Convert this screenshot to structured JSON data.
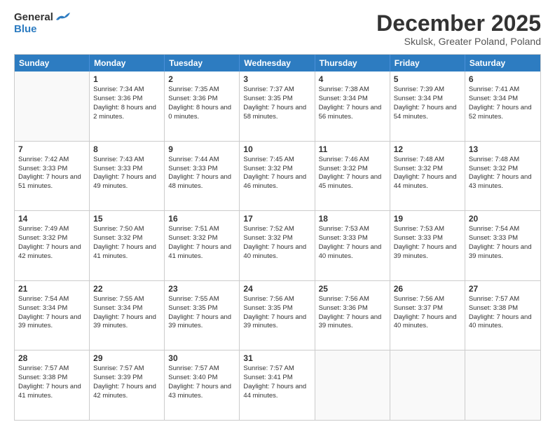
{
  "logo": {
    "line1": "General",
    "line2": "Blue"
  },
  "title": "December 2025",
  "subtitle": "Skulsk, Greater Poland, Poland",
  "header": {
    "days": [
      "Sunday",
      "Monday",
      "Tuesday",
      "Wednesday",
      "Thursday",
      "Friday",
      "Saturday"
    ]
  },
  "weeks": [
    [
      {
        "day": "",
        "sunrise": "",
        "sunset": "",
        "daylight": ""
      },
      {
        "day": "1",
        "sunrise": "Sunrise: 7:34 AM",
        "sunset": "Sunset: 3:36 PM",
        "daylight": "Daylight: 8 hours and 2 minutes."
      },
      {
        "day": "2",
        "sunrise": "Sunrise: 7:35 AM",
        "sunset": "Sunset: 3:36 PM",
        "daylight": "Daylight: 8 hours and 0 minutes."
      },
      {
        "day": "3",
        "sunrise": "Sunrise: 7:37 AM",
        "sunset": "Sunset: 3:35 PM",
        "daylight": "Daylight: 7 hours and 58 minutes."
      },
      {
        "day": "4",
        "sunrise": "Sunrise: 7:38 AM",
        "sunset": "Sunset: 3:34 PM",
        "daylight": "Daylight: 7 hours and 56 minutes."
      },
      {
        "day": "5",
        "sunrise": "Sunrise: 7:39 AM",
        "sunset": "Sunset: 3:34 PM",
        "daylight": "Daylight: 7 hours and 54 minutes."
      },
      {
        "day": "6",
        "sunrise": "Sunrise: 7:41 AM",
        "sunset": "Sunset: 3:34 PM",
        "daylight": "Daylight: 7 hours and 52 minutes."
      }
    ],
    [
      {
        "day": "7",
        "sunrise": "Sunrise: 7:42 AM",
        "sunset": "Sunset: 3:33 PM",
        "daylight": "Daylight: 7 hours and 51 minutes."
      },
      {
        "day": "8",
        "sunrise": "Sunrise: 7:43 AM",
        "sunset": "Sunset: 3:33 PM",
        "daylight": "Daylight: 7 hours and 49 minutes."
      },
      {
        "day": "9",
        "sunrise": "Sunrise: 7:44 AM",
        "sunset": "Sunset: 3:33 PM",
        "daylight": "Daylight: 7 hours and 48 minutes."
      },
      {
        "day": "10",
        "sunrise": "Sunrise: 7:45 AM",
        "sunset": "Sunset: 3:32 PM",
        "daylight": "Daylight: 7 hours and 46 minutes."
      },
      {
        "day": "11",
        "sunrise": "Sunrise: 7:46 AM",
        "sunset": "Sunset: 3:32 PM",
        "daylight": "Daylight: 7 hours and 45 minutes."
      },
      {
        "day": "12",
        "sunrise": "Sunrise: 7:48 AM",
        "sunset": "Sunset: 3:32 PM",
        "daylight": "Daylight: 7 hours and 44 minutes."
      },
      {
        "day": "13",
        "sunrise": "Sunrise: 7:48 AM",
        "sunset": "Sunset: 3:32 PM",
        "daylight": "Daylight: 7 hours and 43 minutes."
      }
    ],
    [
      {
        "day": "14",
        "sunrise": "Sunrise: 7:49 AM",
        "sunset": "Sunset: 3:32 PM",
        "daylight": "Daylight: 7 hours and 42 minutes."
      },
      {
        "day": "15",
        "sunrise": "Sunrise: 7:50 AM",
        "sunset": "Sunset: 3:32 PM",
        "daylight": "Daylight: 7 hours and 41 minutes."
      },
      {
        "day": "16",
        "sunrise": "Sunrise: 7:51 AM",
        "sunset": "Sunset: 3:32 PM",
        "daylight": "Daylight: 7 hours and 41 minutes."
      },
      {
        "day": "17",
        "sunrise": "Sunrise: 7:52 AM",
        "sunset": "Sunset: 3:32 PM",
        "daylight": "Daylight: 7 hours and 40 minutes."
      },
      {
        "day": "18",
        "sunrise": "Sunrise: 7:53 AM",
        "sunset": "Sunset: 3:33 PM",
        "daylight": "Daylight: 7 hours and 40 minutes."
      },
      {
        "day": "19",
        "sunrise": "Sunrise: 7:53 AM",
        "sunset": "Sunset: 3:33 PM",
        "daylight": "Daylight: 7 hours and 39 minutes."
      },
      {
        "day": "20",
        "sunrise": "Sunrise: 7:54 AM",
        "sunset": "Sunset: 3:33 PM",
        "daylight": "Daylight: 7 hours and 39 minutes."
      }
    ],
    [
      {
        "day": "21",
        "sunrise": "Sunrise: 7:54 AM",
        "sunset": "Sunset: 3:34 PM",
        "daylight": "Daylight: 7 hours and 39 minutes."
      },
      {
        "day": "22",
        "sunrise": "Sunrise: 7:55 AM",
        "sunset": "Sunset: 3:34 PM",
        "daylight": "Daylight: 7 hours and 39 minutes."
      },
      {
        "day": "23",
        "sunrise": "Sunrise: 7:55 AM",
        "sunset": "Sunset: 3:35 PM",
        "daylight": "Daylight: 7 hours and 39 minutes."
      },
      {
        "day": "24",
        "sunrise": "Sunrise: 7:56 AM",
        "sunset": "Sunset: 3:35 PM",
        "daylight": "Daylight: 7 hours and 39 minutes."
      },
      {
        "day": "25",
        "sunrise": "Sunrise: 7:56 AM",
        "sunset": "Sunset: 3:36 PM",
        "daylight": "Daylight: 7 hours and 39 minutes."
      },
      {
        "day": "26",
        "sunrise": "Sunrise: 7:56 AM",
        "sunset": "Sunset: 3:37 PM",
        "daylight": "Daylight: 7 hours and 40 minutes."
      },
      {
        "day": "27",
        "sunrise": "Sunrise: 7:57 AM",
        "sunset": "Sunset: 3:38 PM",
        "daylight": "Daylight: 7 hours and 40 minutes."
      }
    ],
    [
      {
        "day": "28",
        "sunrise": "Sunrise: 7:57 AM",
        "sunset": "Sunset: 3:38 PM",
        "daylight": "Daylight: 7 hours and 41 minutes."
      },
      {
        "day": "29",
        "sunrise": "Sunrise: 7:57 AM",
        "sunset": "Sunset: 3:39 PM",
        "daylight": "Daylight: 7 hours and 42 minutes."
      },
      {
        "day": "30",
        "sunrise": "Sunrise: 7:57 AM",
        "sunset": "Sunset: 3:40 PM",
        "daylight": "Daylight: 7 hours and 43 minutes."
      },
      {
        "day": "31",
        "sunrise": "Sunrise: 7:57 AM",
        "sunset": "Sunset: 3:41 PM",
        "daylight": "Daylight: 7 hours and 44 minutes."
      },
      {
        "day": "",
        "sunrise": "",
        "sunset": "",
        "daylight": ""
      },
      {
        "day": "",
        "sunrise": "",
        "sunset": "",
        "daylight": ""
      },
      {
        "day": "",
        "sunrise": "",
        "sunset": "",
        "daylight": ""
      }
    ]
  ]
}
